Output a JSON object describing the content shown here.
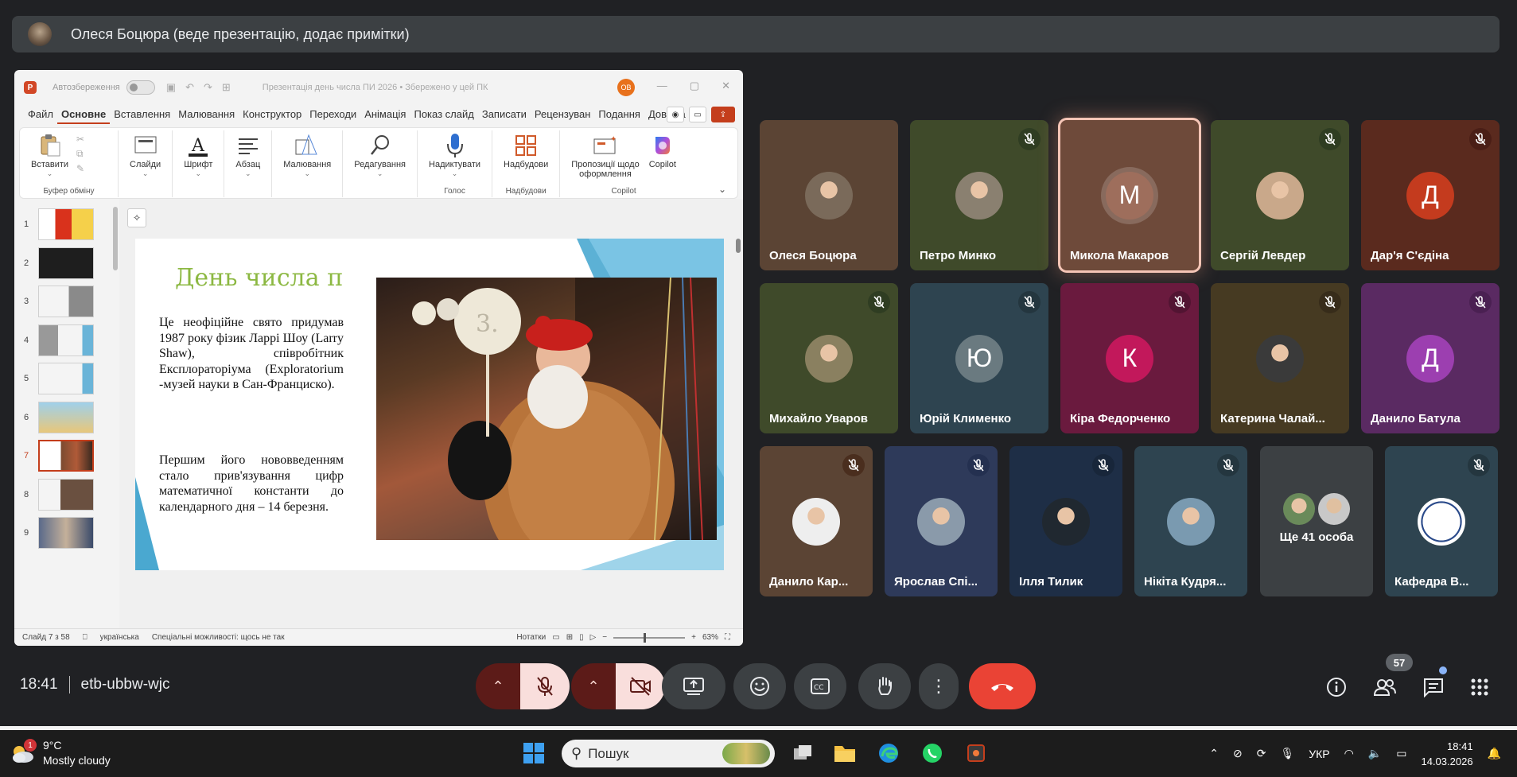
{
  "presenter": {
    "name": "Олеся Боцюра (веде презентацію, додає примітки)"
  },
  "ppt": {
    "title": {
      "autosave_label": "Автозбереження",
      "document_name": "Презентація день числа ПИ 2026 • Збережено у цей ПК",
      "user_initials": "ОВ"
    },
    "tabs": [
      "Файл",
      "Основне",
      "Вставлення",
      "Малювання",
      "Конструктор",
      "Переходи",
      "Анімація",
      "Показ слайд",
      "Записати",
      "Рецензуван",
      "Подання",
      "Довідка"
    ],
    "ribbon": {
      "paste": "Вставити",
      "clipboard_group": "Буфер обміну",
      "slides": "Слайди",
      "font": "Шрифт",
      "paragraph": "Абзац",
      "drawing": "Малювання",
      "editing": "Редагування",
      "dictate": "Надиктувати",
      "voice_group": "Голос",
      "addins": "Надбудови",
      "addins_group": "Надбудови",
      "design_ideas_1": "Пропозиції щодо",
      "design_ideas_2": "оформлення",
      "copilot": "Copilot",
      "copilot_group": "Copilot"
    },
    "slide_numbers": [
      "1",
      "2",
      "3",
      "4",
      "5",
      "6",
      "7",
      "8",
      "9"
    ],
    "slide": {
      "title": "День числа π",
      "paragraph1": "Це неофіційне свято придумав 1987 року фізик Ларрі Шоу (Larry Shaw), співробітник Експлораторіума (Exploratorium -музей науки в Сан-Франциско).",
      "paragraph2": "Першим його нововведенням стало прив'язування цифр математичної константи до календарного дня – 14 березня.",
      "photo_sign": "3."
    },
    "status": {
      "slide_counter": "Слайд 7 з 58",
      "language": "українська",
      "accessibility": "Спеціальні можливості: щось не так",
      "notes": "Нотатки",
      "zoom": "63%"
    }
  },
  "participants": [
    {
      "name": "Олеся Боцюра",
      "muted": false,
      "bg": "#5b4434",
      "kind": "photo",
      "photo_color": "#7a6a5a"
    },
    {
      "name": "Петро Минко",
      "muted": true,
      "bg": "#3f4a2a",
      "kind": "photo",
      "photo_color": "#8a8070",
      "mute_color": "#2f3d22"
    },
    {
      "name": "Микола Макаров",
      "muted": false,
      "bg": "#6e4a3a",
      "kind": "letter",
      "letter": "М",
      "avatar_color": "#9e6e5c",
      "active": true
    },
    {
      "name": "Сергій Левдер",
      "muted": true,
      "bg": "#3f4a2a",
      "kind": "photo",
      "photo_color": "#c9a88a",
      "mute_color": "#2f3d22"
    },
    {
      "name": "Дар'я С'єдіна",
      "muted": true,
      "bg": "#5a2a1e",
      "kind": "letter",
      "letter": "Д",
      "avatar_color": "#c43b1e",
      "mute_color": "#4a1e16"
    },
    {
      "name": "Михайло Уваров",
      "muted": true,
      "bg": "#3f4a2a",
      "kind": "photo",
      "photo_color": "#8a8060",
      "mute_color": "#2f3d22"
    },
    {
      "name": "Юрій Клименко",
      "muted": true,
      "bg": "#2e4450",
      "kind": "letter",
      "letter": "Ю",
      "avatar_color": "#6a7a80",
      "mute_color": "#24363f"
    },
    {
      "name": "Кіра Федорченко",
      "muted": true,
      "bg": "#6a1a3e",
      "kind": "letter",
      "letter": "К",
      "avatar_color": "#c2185b",
      "mute_color": "#521432"
    },
    {
      "name": "Катерина Чалай...",
      "muted": true,
      "bg": "#463a22",
      "kind": "photo",
      "photo_color": "#3a3a3a",
      "mute_color": "#372c1a"
    },
    {
      "name": "Данило Батула",
      "muted": true,
      "bg": "#5a2a62",
      "kind": "letter",
      "letter": "Д",
      "avatar_color": "#9c3fb0",
      "mute_color": "#4a2052"
    },
    {
      "name": "Данило Кар...",
      "muted": true,
      "bg": "#5b4434",
      "kind": "photo",
      "photo_color": "#eeeeee",
      "mute_color": "#4a2e1e"
    },
    {
      "name": "Ярослав Спі...",
      "muted": true,
      "bg": "#2e3a5a",
      "kind": "photo",
      "photo_color": "#8a9aaa",
      "mute_color": "#243050"
    },
    {
      "name": "Ілля Тилик",
      "muted": true,
      "bg": "#1e2e46",
      "kind": "photo",
      "photo_color": "#202830",
      "mute_color": "#18263a"
    },
    {
      "name": "Нікіта Кудря...",
      "muted": true,
      "bg": "#2e4450",
      "kind": "photo",
      "photo_color": "#7a9ab0",
      "mute_color": "#24363f"
    },
    {
      "name": "Ще 41 особа",
      "muted": false,
      "bg": "#3c4043",
      "kind": "more"
    },
    {
      "name": "Кафедра В...",
      "muted": true,
      "bg": "#2e4450",
      "kind": "logo",
      "photo_color": "#ffffff",
      "mute_color": "#24363f"
    }
  ],
  "meeting": {
    "time": "18:41",
    "code": "etb-ubbw-wjc",
    "participant_count": "57"
  },
  "taskbar": {
    "weather_temp": "9°C",
    "weather_desc": "Mostly cloudy",
    "weather_badge": "1",
    "search_placeholder": "Пошук",
    "language": "УКР",
    "clock_time": "18:41",
    "clock_date": "14.03.2026"
  }
}
